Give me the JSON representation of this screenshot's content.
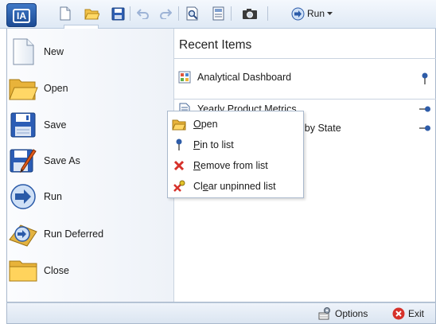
{
  "toolbar": {
    "app_logo": "IA",
    "run_label": "Run",
    "icons": [
      "new-icon",
      "open-icon",
      "save-icon",
      "undo-icon",
      "redo-icon",
      "print-preview-icon",
      "properties-icon",
      "snapshot-icon",
      "run-icon"
    ]
  },
  "commands": [
    {
      "id": "new",
      "label": "New",
      "icon": "new-document-icon"
    },
    {
      "id": "open",
      "label": "Open",
      "icon": "folder-open-icon"
    },
    {
      "id": "save",
      "label": "Save",
      "icon": "floppy-disk-icon"
    },
    {
      "id": "save-as",
      "label": "Save As",
      "icon": "save-as-icon"
    },
    {
      "id": "run",
      "label": "Run",
      "icon": "run-arrow-icon"
    },
    {
      "id": "run-deferred",
      "label": "Run Deferred",
      "icon": "run-deferred-icon"
    },
    {
      "id": "close",
      "label": "Close",
      "icon": "folder-closed-icon"
    }
  ],
  "recent": {
    "title": "Recent Items",
    "items": [
      {
        "label": "Analytical Dashboard",
        "icon": "dashboard-icon",
        "pinned": true
      },
      {
        "label": "Yearly Product Metrics",
        "icon": "report-icon",
        "pinned": false
      },
      {
        "label": "Choropleth Map - Sales by State",
        "icon": "chart-icon",
        "pinned": false
      }
    ]
  },
  "context_menu": {
    "items": [
      {
        "label": "Open",
        "accel": "O",
        "rest": "pen",
        "pre": ""
      },
      {
        "label": "Pin to list",
        "accel": "P",
        "rest": "in to list",
        "pre": ""
      },
      {
        "label": "Remove from list",
        "accel": "R",
        "rest": "emove from list",
        "pre": ""
      },
      {
        "label": "Clear unpinned list",
        "accel": "e",
        "rest": "ar unpinned list",
        "pre": "Cl"
      }
    ]
  },
  "footer": {
    "options_label": "Options",
    "exit_label": "Exit"
  },
  "colors": {
    "accent": "#1c4b94",
    "menu_border": "#a9b8cc",
    "exit_red": "#d6312a"
  }
}
